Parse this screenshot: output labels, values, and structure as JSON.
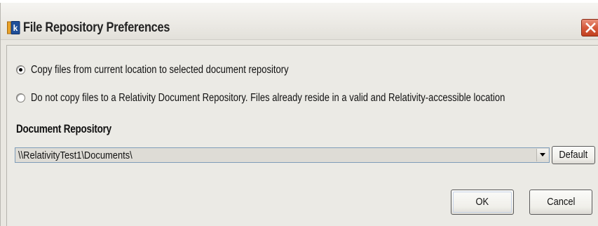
{
  "window": {
    "title": "File Repository Preferences",
    "app_icon": "relativity-app-icon",
    "close_icon": "close-icon",
    "close_color": "#d65a3c"
  },
  "options": {
    "copy_files_label": "Copy files from current location to selected document repository",
    "copy_files_selected": true,
    "no_copy_label": "Do not copy files to a Relativity Document Repository. Files already reside in a valid and Relativity-accessible location",
    "no_copy_selected": false
  },
  "repository": {
    "section_label": "Document Repository",
    "selected_value": "\\\\RelativityTest1\\Documents\\",
    "dropdown_icon": "chevron-down-icon",
    "default_button_label": "Default"
  },
  "actions": {
    "ok_label": "OK",
    "cancel_label": "Cancel"
  }
}
